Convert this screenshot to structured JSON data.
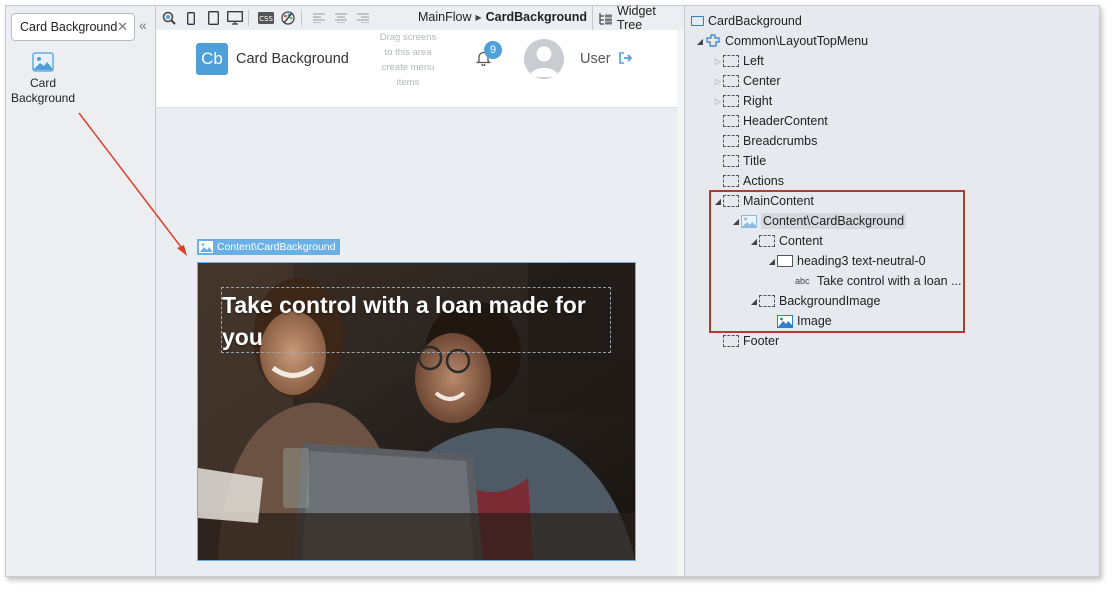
{
  "toolbox": {
    "search_value": "Card Background",
    "clear_glyph": "✕",
    "collapse_glyph": "«",
    "item_label": "Card Background"
  },
  "toolbar": {
    "breadcrumb_flow": "MainFlow",
    "breadcrumb_screen": "CardBackground",
    "widget_tree_label": "Widget Tree"
  },
  "canvas": {
    "logo_text": "Cb",
    "app_title": "Card Background",
    "drag_hint": "Drag screens to this area create menu items",
    "notification_count": "9",
    "user_name": "User",
    "content_tag": "Content\\CardBackground",
    "heading": "Take control with a loan made for you"
  },
  "tree": {
    "root": "CardBackground",
    "layout": "Common\\LayoutTopMenu",
    "left": "Left",
    "center": "Center",
    "right": "Right",
    "header_content": "HeaderContent",
    "breadcrumbs": "Breadcrumbs",
    "title": "Title",
    "actions": "Actions",
    "main_content": "MainContent",
    "content_card": "Content\\CardBackground",
    "content": "Content",
    "heading_widget": "heading3 text-neutral-0",
    "text_widget": "Take control with a loan ...",
    "background_image": "BackgroundImage",
    "image": "Image",
    "footer": "Footer",
    "abc_glyph": "abc"
  },
  "colors": {
    "accent": "#4f9fd8",
    "highlight": "#b23a2e",
    "annotation_arrow": "#e0402a"
  }
}
